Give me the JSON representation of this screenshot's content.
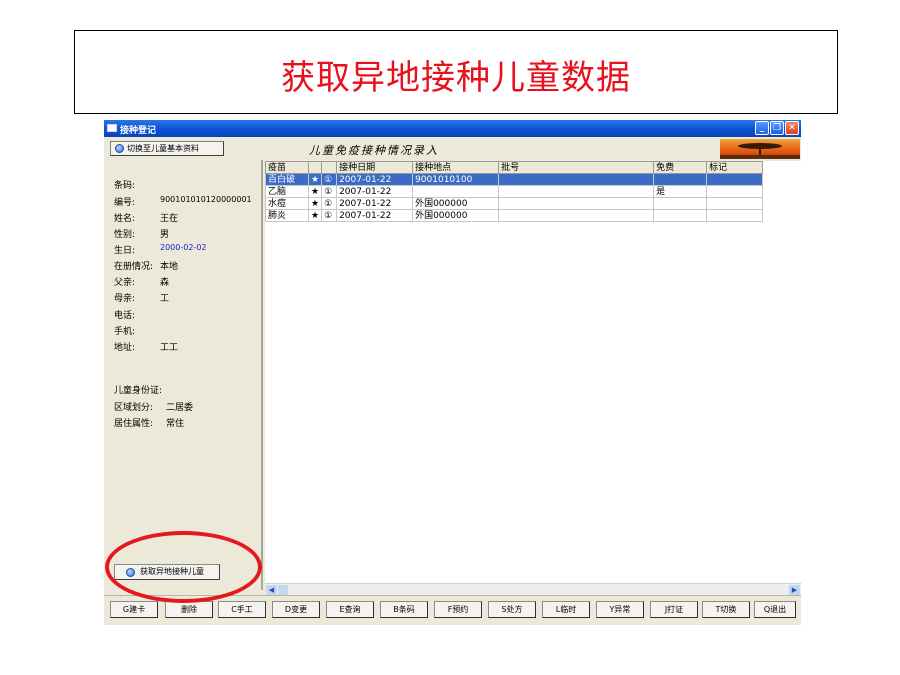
{
  "slide": {
    "title": "获取异地接种儿童数据"
  },
  "window": {
    "title": "接种登记",
    "controls": [
      "_",
      "❐",
      "✕"
    ],
    "header_title": "儿童免疫接种情况录入",
    "switch_button": "切换至儿童基本资料"
  },
  "child": {
    "fields": [
      {
        "label": "条码:",
        "value": ""
      },
      {
        "label": "编号:",
        "value": "900101010120000001"
      },
      {
        "label": "姓名:",
        "value": "王在"
      },
      {
        "label": "性别:",
        "value": "男"
      },
      {
        "label": "生日:",
        "value": "2000-02-02"
      },
      {
        "label": "在册情况:",
        "value": "本地"
      },
      {
        "label": "父亲:",
        "value": "森"
      },
      {
        "label": "母亲:",
        "value": "工"
      },
      {
        "label": "电话:",
        "value": ""
      },
      {
        "label": "手机:",
        "value": ""
      },
      {
        "label": "地址:",
        "value": "工工"
      }
    ],
    "extra": [
      {
        "label": "儿童身份证:",
        "value": ""
      },
      {
        "label": "区域划分:",
        "value": "二居委"
      },
      {
        "label": "居住属性:",
        "value": "常住"
      }
    ],
    "remote_button": "获取异地接种儿童"
  },
  "table": {
    "headers": [
      "疫苗",
      "",
      "",
      "接种日期",
      "接种地点",
      "批号",
      "免费",
      "标记"
    ],
    "rows": [
      [
        "百白破",
        "★",
        "①",
        "2007-01-22",
        "9001010100",
        "",
        "",
        ""
      ],
      [
        "乙脑",
        "★",
        "①",
        "2007-01-22",
        "",
        "",
        "是",
        ""
      ],
      [
        "水痘",
        "★",
        "①",
        "2007-01-22",
        "外国000000",
        "",
        "",
        ""
      ],
      [
        "肺炎",
        "★",
        "①",
        "2007-01-22",
        "外国000000",
        "",
        "",
        ""
      ]
    ],
    "selected_row": 0
  },
  "buttons": [
    "G建卡",
    "删除",
    "C手工",
    "D变更",
    "E查询",
    "B条码",
    "F预约",
    "S处方",
    "L临时",
    "Y异常",
    "J打证",
    "T切换",
    "Q退出"
  ],
  "colors": {
    "title": "#e8101a",
    "selection": "#3b6bc4",
    "highlight_oval": "#e5171f",
    "birthday": "#1a1ad8"
  }
}
